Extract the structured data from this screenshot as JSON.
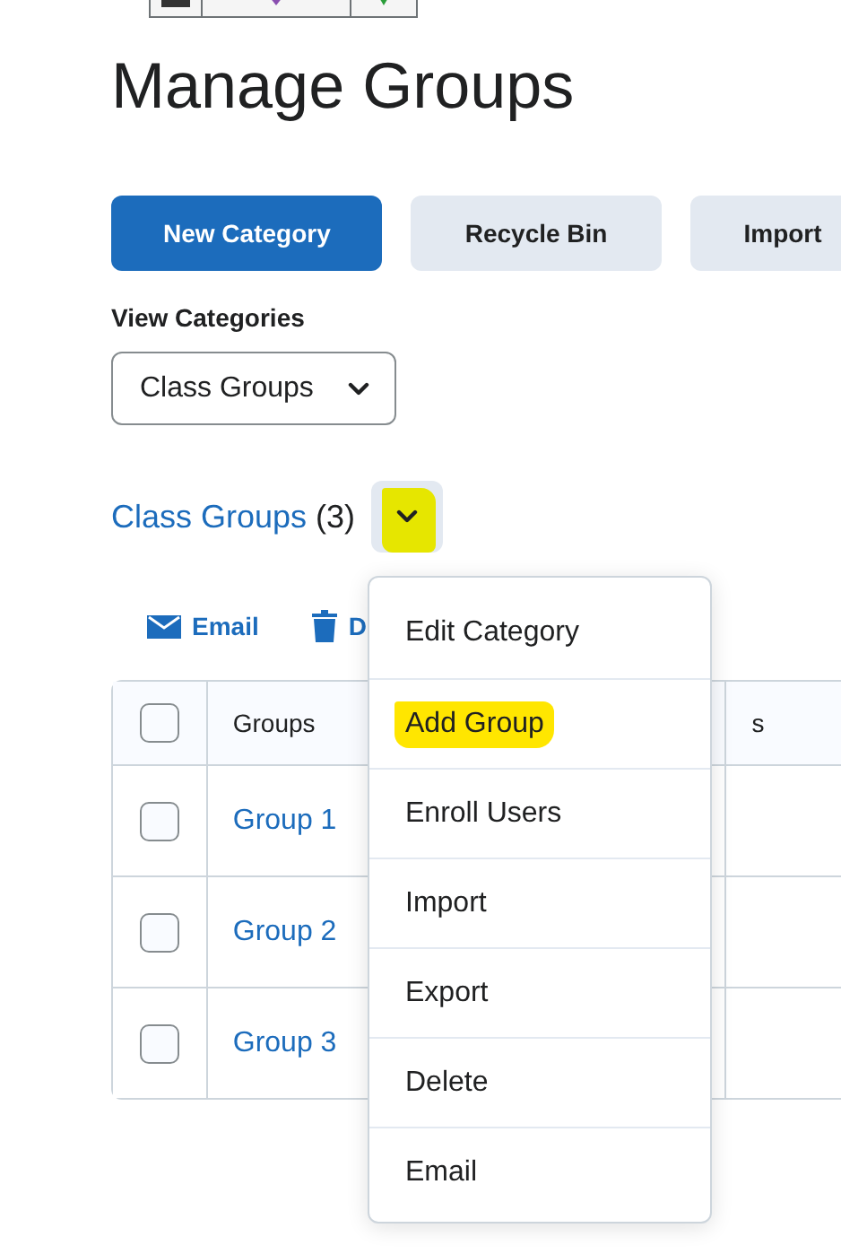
{
  "page": {
    "title": "Manage Groups"
  },
  "actions": [
    {
      "label": "New Category",
      "kind": "primary"
    },
    {
      "label": "Recycle Bin",
      "kind": "secondary"
    },
    {
      "label": "Import",
      "kind": "secondary"
    }
  ],
  "view_categories": {
    "label": "View Categories",
    "value": "Class Groups"
  },
  "category": {
    "name": "Class Groups",
    "count": "(3)",
    "menu_button_highlighted": true
  },
  "toolbar": [
    {
      "label": "Email",
      "kind": "email"
    },
    {
      "label": "D",
      "kind": "delete"
    }
  ],
  "table": {
    "columns": [
      "Groups",
      "s"
    ],
    "header_checked": false,
    "rows": [
      {
        "name": "Group 1",
        "checked": false
      },
      {
        "name": "Group 2",
        "checked": false
      },
      {
        "name": "Group 3",
        "checked": false
      }
    ]
  },
  "menu": {
    "items": [
      {
        "label": "Edit Category",
        "highlighted": false
      },
      {
        "label": "Add Group",
        "highlighted": true
      },
      {
        "label": "Enroll Users",
        "highlighted": false
      },
      {
        "label": "Import",
        "highlighted": false
      },
      {
        "label": "Export",
        "highlighted": false
      },
      {
        "label": "Delete",
        "highlighted": false
      },
      {
        "label": "Email",
        "highlighted": false
      }
    ]
  }
}
